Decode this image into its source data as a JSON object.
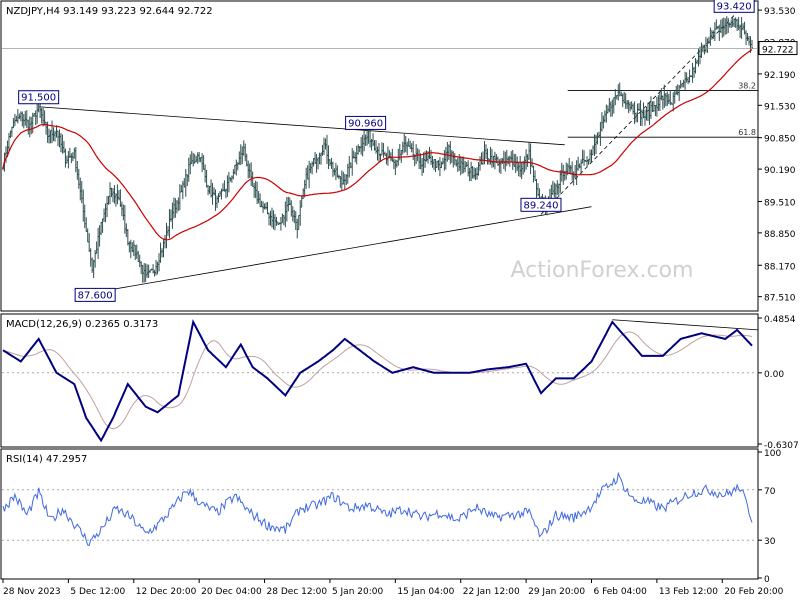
{
  "colors": {
    "background": "#ffffff",
    "grid": "#a9a9a9",
    "price": "#2f4f4f",
    "ma": "#cc0000",
    "macd": "#000080",
    "signal": "#c0a0a0",
    "rsi": "#4169e1",
    "label_box": "#000080",
    "fibo": "#000000",
    "watermark": "#d0d0d0"
  },
  "watermark": "ActionForex.com",
  "chart_data": [
    {
      "type": "candlestick",
      "title": "NZDJPY,H4  93.149 93.223 92.644 92.722",
      "ylim": [
        87.23,
        93.7
      ],
      "y_ticks": [
        "93.530",
        "92.870",
        "92.190",
        "91.530",
        "90.850",
        "90.190",
        "89.510",
        "88.850",
        "88.170",
        "87.510"
      ],
      "y_tick_values": [
        93.53,
        92.87,
        92.19,
        91.53,
        90.85,
        90.19,
        89.51,
        88.85,
        88.17,
        87.51
      ],
      "current_price": "92.722",
      "current_price_value": 92.722,
      "x_ticks": [
        "28 Nov 2023",
        "5 Dec 12:00",
        "12 Dec 20:00",
        "20 Dec 04:00",
        "28 Dec 12:00",
        "5 Jan 20:00",
        "15 Jan 04:00",
        "22 Jan 12:00",
        "29 Jan 20:00",
        "6 Feb 04:00",
        "13 Feb 12:00",
        "20 Feb 20:00"
      ],
      "x_tick_bars": [
        0,
        44,
        88,
        132,
        176,
        220,
        264,
        308,
        352,
        396,
        440,
        484
      ],
      "bar_count": 505,
      "closes_anchors": [
        [
          0,
          90.3
        ],
        [
          6,
          91.1
        ],
        [
          12,
          91.3
        ],
        [
          18,
          91.1
        ],
        [
          24,
          91.5
        ],
        [
          30,
          90.9
        ],
        [
          36,
          91.0
        ],
        [
          42,
          90.4
        ],
        [
          48,
          90.5
        ],
        [
          54,
          89.3
        ],
        [
          60,
          88.1
        ],
        [
          66,
          89.0
        ],
        [
          72,
          89.7
        ],
        [
          78,
          89.6
        ],
        [
          84,
          88.7
        ],
        [
          90,
          88.4
        ],
        [
          96,
          87.9
        ],
        [
          102,
          88.1
        ],
        [
          108,
          88.6
        ],
        [
          114,
          89.3
        ],
        [
          120,
          89.7
        ],
        [
          126,
          90.3
        ],
        [
          132,
          90.5
        ],
        [
          138,
          89.8
        ],
        [
          144,
          89.5
        ],
        [
          150,
          89.8
        ],
        [
          156,
          90.2
        ],
        [
          162,
          90.6
        ],
        [
          168,
          89.8
        ],
        [
          174,
          89.4
        ],
        [
          180,
          89.2
        ],
        [
          186,
          89.0
        ],
        [
          192,
          89.5
        ],
        [
          198,
          89.0
        ],
        [
          204,
          90.0
        ],
        [
          210,
          90.4
        ],
        [
          216,
          90.7
        ],
        [
          222,
          90.2
        ],
        [
          228,
          89.9
        ],
        [
          234,
          90.3
        ],
        [
          240,
          90.7
        ],
        [
          246,
          90.9
        ],
        [
          252,
          90.6
        ],
        [
          258,
          90.4
        ],
        [
          264,
          90.3
        ],
        [
          270,
          90.7
        ],
        [
          276,
          90.5
        ],
        [
          282,
          90.3
        ],
        [
          288,
          90.4
        ],
        [
          294,
          90.2
        ],
        [
          300,
          90.6
        ],
        [
          306,
          90.3
        ],
        [
          312,
          90.2
        ],
        [
          318,
          90.1
        ],
        [
          324,
          90.5
        ],
        [
          330,
          90.4
        ],
        [
          336,
          90.3
        ],
        [
          342,
          90.4
        ],
        [
          348,
          90.2
        ],
        [
          354,
          90.5
        ],
        [
          360,
          89.6
        ],
        [
          366,
          89.4
        ],
        [
          372,
          89.8
        ],
        [
          378,
          90.2
        ],
        [
          384,
          90.1
        ],
        [
          390,
          90.4
        ],
        [
          396,
          90.5
        ],
        [
          402,
          91.0
        ],
        [
          408,
          91.5
        ],
        [
          414,
          91.8
        ],
        [
          420,
          91.6
        ],
        [
          426,
          91.4
        ],
        [
          432,
          91.3
        ],
        [
          438,
          91.5
        ],
        [
          444,
          91.7
        ],
        [
          450,
          91.6
        ],
        [
          456,
          91.9
        ],
        [
          462,
          92.1
        ],
        [
          468,
          92.5
        ],
        [
          474,
          92.9
        ],
        [
          480,
          93.1
        ],
        [
          486,
          93.2
        ],
        [
          492,
          93.3
        ],
        [
          498,
          93.1
        ],
        [
          504,
          92.72
        ]
      ],
      "levels": [
        {
          "label": "38.2",
          "value": 91.84
        },
        {
          "label": "61.8",
          "value": 90.86
        }
      ],
      "annotations": [
        {
          "label": "93.420",
          "bar": 492,
          "value": 93.42
        },
        {
          "label": "91.500",
          "bar": 24,
          "value": 91.5
        },
        {
          "label": "90.960",
          "bar": 244,
          "value": 90.96
        },
        {
          "label": "89.240",
          "bar": 362,
          "value": 89.24
        },
        {
          "label": "87.600",
          "bar": 62,
          "value": 87.6
        }
      ],
      "trendlines": [
        {
          "name": "upper",
          "from": [
            24,
            91.5
          ],
          "to": [
            378,
            90.7
          ]
        },
        {
          "name": "lower",
          "from": [
            62,
            87.6
          ],
          "to": [
            396,
            89.4
          ]
        },
        {
          "name": "rising",
          "from": [
            362,
            89.24
          ],
          "to": [
            492,
            93.42
          ]
        }
      ],
      "ma_lag": 18
    },
    {
      "type": "line",
      "title": "MACD(12,26,9) 0.2365 0.3173",
      "ylim": [
        -0.6307,
        0.4854
      ],
      "y_ticks": [
        "0.4854",
        "0.00",
        "-0.6307"
      ],
      "y_tick_values": [
        0.4854,
        0.0,
        -0.6307
      ],
      "series": [
        {
          "name": "MACD",
          "anchors": [
            [
              0,
              0.2
            ],
            [
              12,
              0.1
            ],
            [
              24,
              0.3
            ],
            [
              36,
              0.0
            ],
            [
              48,
              -0.1
            ],
            [
              56,
              -0.4
            ],
            [
              66,
              -0.6
            ],
            [
              74,
              -0.4
            ],
            [
              84,
              -0.1
            ],
            [
              96,
              -0.3
            ],
            [
              104,
              -0.35
            ],
            [
              118,
              -0.2
            ],
            [
              128,
              0.45
            ],
            [
              138,
              0.2
            ],
            [
              150,
              0.05
            ],
            [
              160,
              0.25
            ],
            [
              168,
              0.05
            ],
            [
              178,
              -0.05
            ],
            [
              190,
              -0.2
            ],
            [
              200,
              0.0
            ],
            [
              212,
              0.1
            ],
            [
              222,
              0.2
            ],
            [
              230,
              0.3
            ],
            [
              240,
              0.2
            ],
            [
              250,
              0.1
            ],
            [
              262,
              0.0
            ],
            [
              276,
              0.05
            ],
            [
              290,
              0.0
            ],
            [
              302,
              0.0
            ],
            [
              314,
              0.0
            ],
            [
              326,
              0.03
            ],
            [
              340,
              0.05
            ],
            [
              352,
              0.08
            ],
            [
              362,
              -0.18
            ],
            [
              372,
              -0.05
            ],
            [
              384,
              -0.05
            ],
            [
              396,
              0.1
            ],
            [
              410,
              0.45
            ],
            [
              420,
              0.3
            ],
            [
              430,
              0.15
            ],
            [
              444,
              0.15
            ],
            [
              456,
              0.3
            ],
            [
              470,
              0.35
            ],
            [
              486,
              0.3
            ],
            [
              494,
              0.38
            ],
            [
              504,
              0.24
            ]
          ]
        },
        {
          "name": "Signal",
          "lag": 6
        }
      ]
    },
    {
      "type": "line",
      "title": "RSI(14) 47.2957",
      "ylim": [
        0,
        100
      ],
      "y_ticks": [
        "100",
        "70",
        "30",
        "0"
      ],
      "y_tick_values": [
        100,
        70,
        30,
        0
      ],
      "series": [
        {
          "name": "RSI",
          "anchors": [
            [
              0,
              55
            ],
            [
              8,
              65
            ],
            [
              16,
              50
            ],
            [
              24,
              68
            ],
            [
              32,
              45
            ],
            [
              40,
              55
            ],
            [
              50,
              40
            ],
            [
              58,
              28
            ],
            [
              66,
              38
            ],
            [
              76,
              55
            ],
            [
              86,
              48
            ],
            [
              96,
              35
            ],
            [
              104,
              42
            ],
            [
              114,
              55
            ],
            [
              124,
              70
            ],
            [
              134,
              58
            ],
            [
              144,
              52
            ],
            [
              156,
              65
            ],
            [
              166,
              52
            ],
            [
              178,
              42
            ],
            [
              190,
              38
            ],
            [
              200,
              55
            ],
            [
              212,
              58
            ],
            [
              222,
              65
            ],
            [
              234,
              55
            ],
            [
              246,
              58
            ],
            [
              258,
              50
            ],
            [
              270,
              55
            ],
            [
              282,
              48
            ],
            [
              294,
              52
            ],
            [
              306,
              46
            ],
            [
              318,
              56
            ],
            [
              330,
              48
            ],
            [
              342,
              50
            ],
            [
              354,
              52
            ],
            [
              362,
              32
            ],
            [
              372,
              50
            ],
            [
              384,
              48
            ],
            [
              394,
              55
            ],
            [
              404,
              70
            ],
            [
              414,
              80
            ],
            [
              424,
              62
            ],
            [
              434,
              60
            ],
            [
              444,
              55
            ],
            [
              454,
              62
            ],
            [
              464,
              68
            ],
            [
              474,
              70
            ],
            [
              486,
              66
            ],
            [
              496,
              72
            ],
            [
              504,
              47
            ]
          ]
        }
      ]
    }
  ]
}
